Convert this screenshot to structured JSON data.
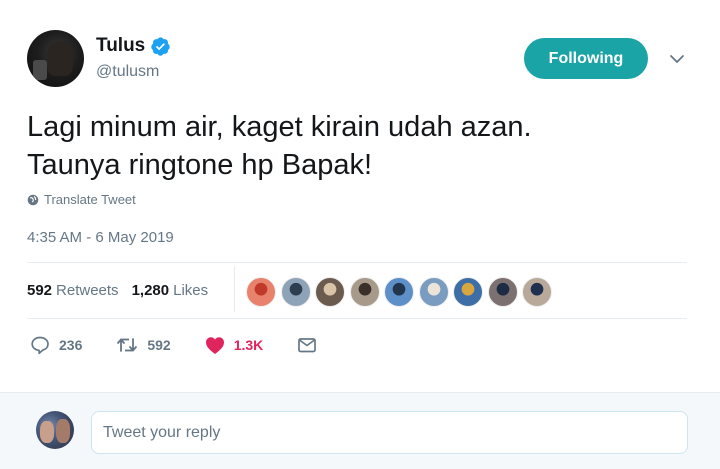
{
  "user": {
    "display_name": "Tulus",
    "handle": "@tulusm",
    "verified_icon": "verified-badge-icon",
    "follow_label": "Following"
  },
  "tweet": {
    "lines": [
      "Lagi minum air, kaget kirain udah azan.",
      "Taunya ringtone hp Bapak!"
    ],
    "translate_label": "Translate Tweet",
    "timestamp": "4:35 AM - 6 May 2019"
  },
  "stats": {
    "retweets_count": "592",
    "retweets_label": "Retweets",
    "likes_count": "1,280",
    "likes_label": "Likes"
  },
  "likers": [
    {
      "color": "#e8826c",
      "accent": "#c0392b"
    },
    {
      "color": "#8fa3b8",
      "accent": "#2c3e50"
    },
    {
      "color": "#6b5b4e",
      "accent": "#d9c2a7"
    },
    {
      "color": "#a89a8a",
      "accent": "#3b2f2a"
    },
    {
      "color": "#5d8fc9",
      "accent": "#22354d"
    },
    {
      "color": "#7a9cc0",
      "accent": "#ede4d8"
    },
    {
      "color": "#3e6ea6",
      "accent": "#d8a640"
    },
    {
      "color": "#7c7070",
      "accent": "#1d2b45"
    },
    {
      "color": "#b8a99a",
      "accent": "#203050"
    }
  ],
  "actions": {
    "reply_count": "236",
    "retweet_count": "592",
    "like_count": "1.3K"
  },
  "reply": {
    "placeholder": "Tweet your reply"
  },
  "colors": {
    "accent": "#1ba4a6",
    "like": "#e0245e",
    "verified": "#1da1f2",
    "muted": "#657786"
  }
}
